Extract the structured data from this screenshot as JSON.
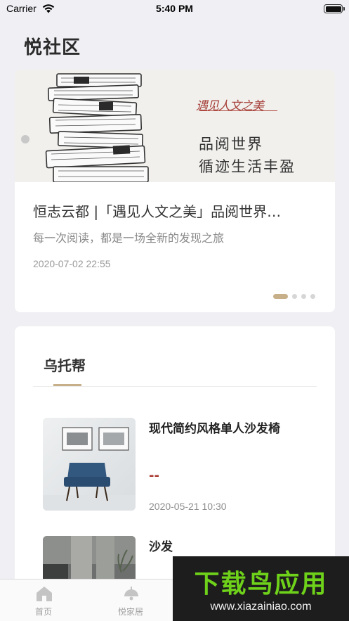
{
  "status_bar": {
    "carrier": "Carrier",
    "time": "5:40 PM"
  },
  "page": {
    "title": "悦社区"
  },
  "banner": {
    "logo_text": "遇见人文之美",
    "slogan_line1": "品阅世界",
    "slogan_line2": "循迹生活丰盈",
    "carousel_pages": 4,
    "active_page": 1
  },
  "article": {
    "title": "恒志云都 |「遇见人文之美」品阅世界…",
    "subtitle": "每一次阅读，都是一场全新的发现之旅",
    "date": "2020-07-02 22:55"
  },
  "section": {
    "title": "乌托帮"
  },
  "products": [
    {
      "name": "现代简约风格单人沙发椅",
      "price": "--",
      "date": "2020-05-21 10:30"
    },
    {
      "name": "沙发"
    }
  ],
  "tab_bar": {
    "tabs": [
      {
        "label": "首页",
        "icon": "home-icon"
      },
      {
        "label": "悦家居",
        "icon": "lamp-icon"
      }
    ]
  },
  "watermark": {
    "title": "下载鸟应用",
    "url": "www.xiazainiao.com"
  }
}
